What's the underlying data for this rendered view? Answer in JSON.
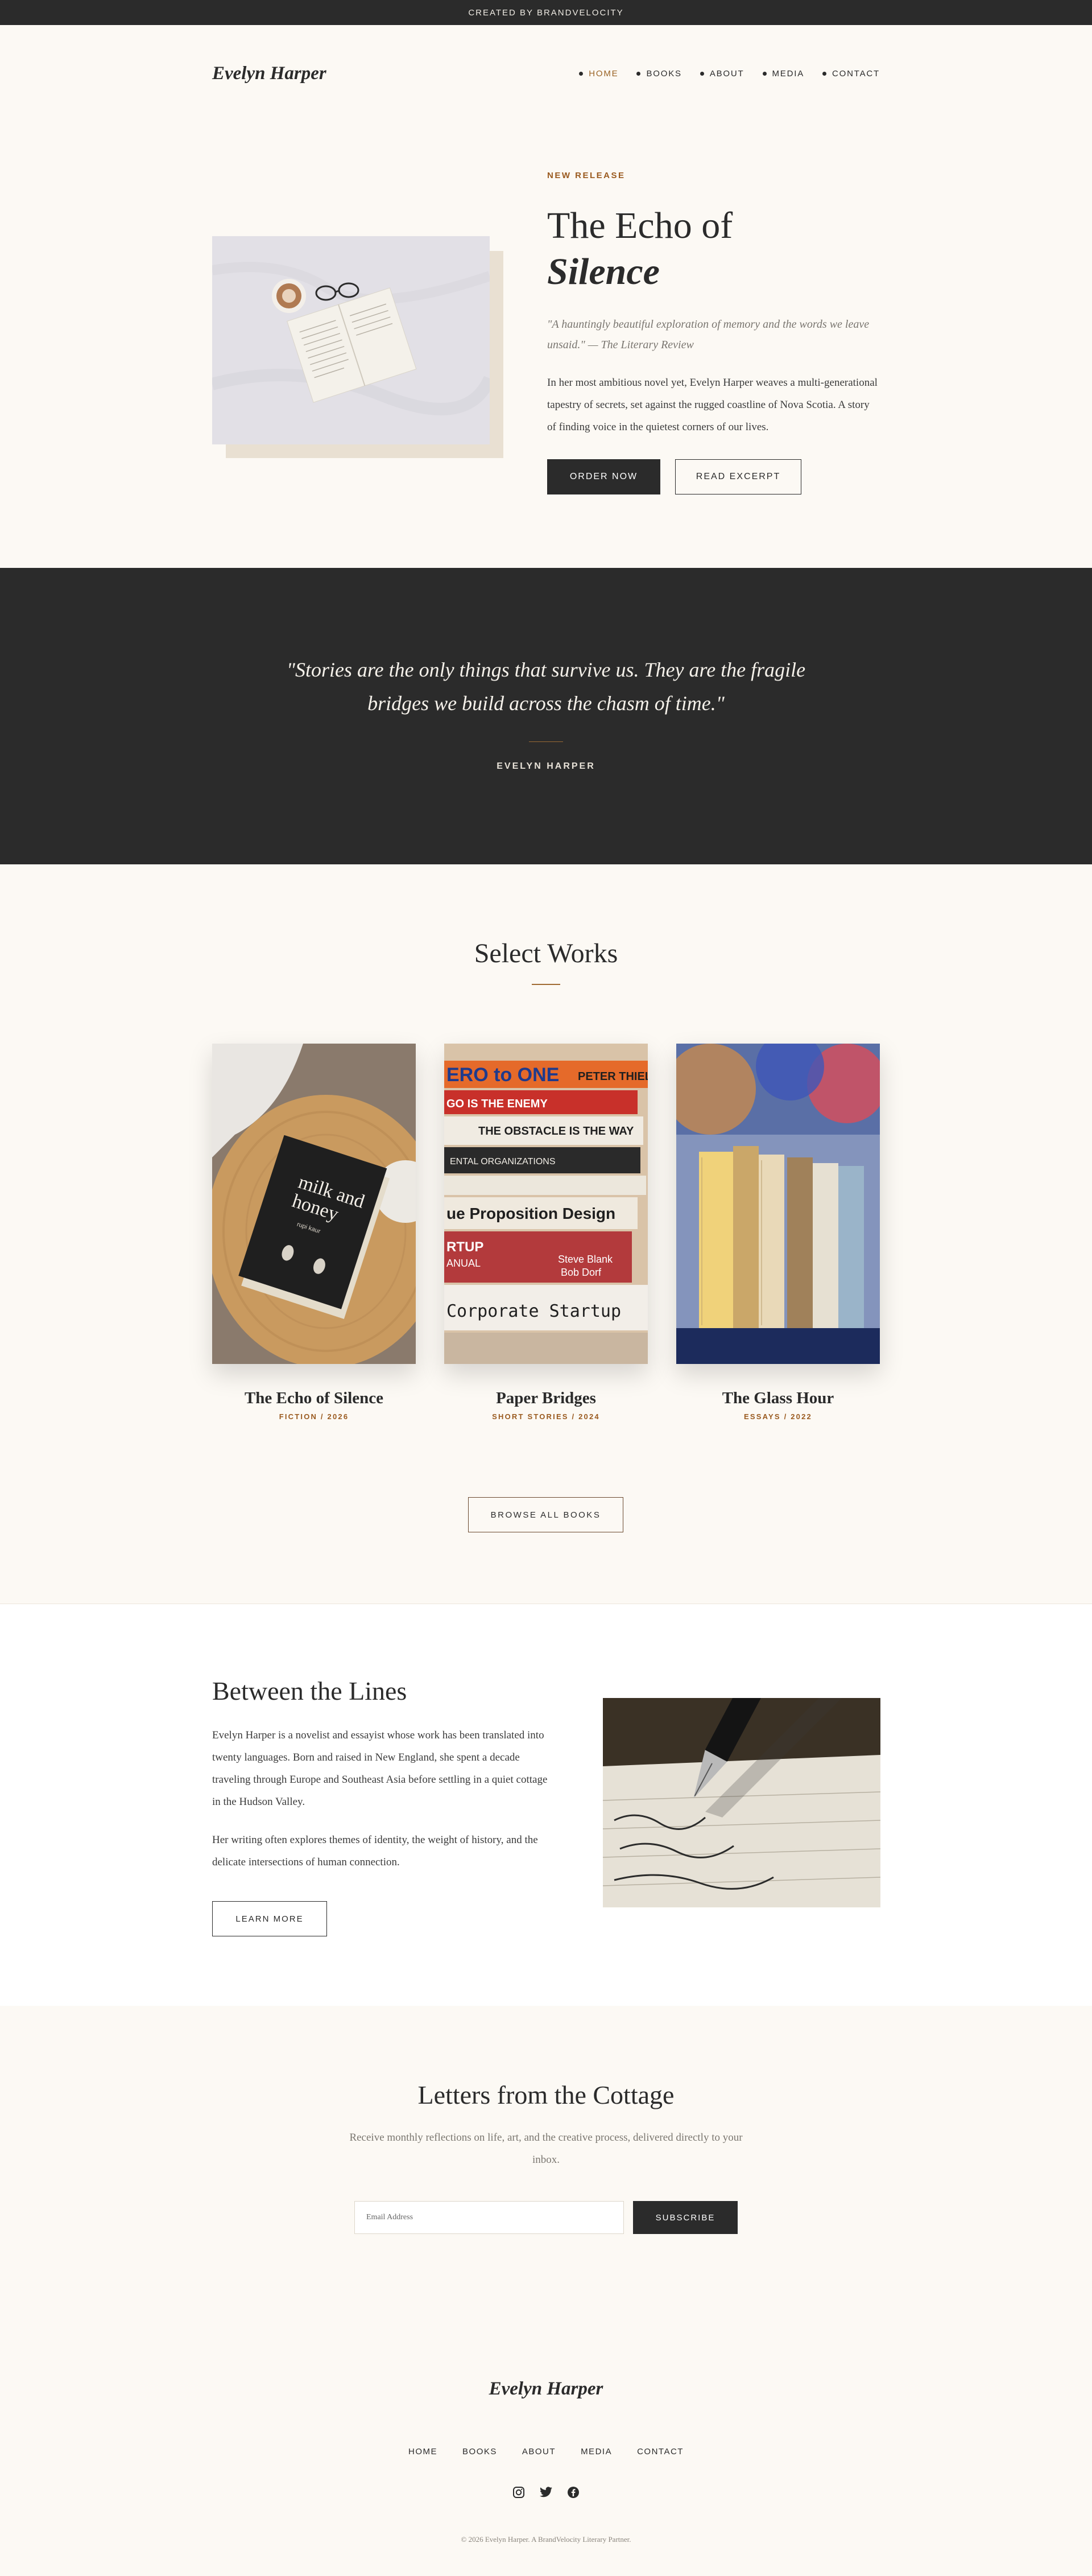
{
  "banner": {
    "text": "CREATED BY BRANDVELOCITY"
  },
  "header": {
    "logo": "Evelyn Harper",
    "nav": [
      {
        "label": "HOME",
        "active": true
      },
      {
        "label": "BOOKS",
        "active": false
      },
      {
        "label": "ABOUT",
        "active": false
      },
      {
        "label": "MEDIA",
        "active": false
      },
      {
        "label": "CONTACT",
        "active": false
      }
    ]
  },
  "hero": {
    "eyebrow": "NEW RELEASE",
    "title_line1": "The Echo of",
    "title_line2": "Silence",
    "quote": "\"A hauntingly beautiful exploration of memory and the words we leave unsaid.\" — The Literary Review",
    "description": "In her most ambitious novel yet, Evelyn Harper weaves a multi-generational tapestry of secrets, set against the rugged coastline of Nova Scotia. A story of finding voice in the quietest corners of our lives.",
    "order_button": "ORDER NOW",
    "excerpt_button": "READ EXCERPT"
  },
  "quote_band": {
    "quote": "\"Stories are the only things that survive us. They are the fragile bridges we build across the chasm of time.\"",
    "author": "EVELYN HARPER"
  },
  "works": {
    "title": "Select Works",
    "books": [
      {
        "title": "The Echo of Silence",
        "meta": "FICTION / 2026"
      },
      {
        "title": "Paper Bridges",
        "meta": "SHORT STORIES / 2024"
      },
      {
        "title": "The Glass Hour",
        "meta": "ESSAYS / 2022"
      }
    ],
    "browse_button": "BROWSE ALL BOOKS"
  },
  "about": {
    "title": "Between the Lines",
    "p1": "Evelyn Harper is a novelist and essayist whose work has been translated into twenty languages. Born and raised in New England, she spent a decade traveling through Europe and Southeast Asia before settling in a quiet cottage in the Hudson Valley.",
    "p2": "Her writing often explores themes of identity, the weight of history, and the delicate intersections of human connection.",
    "button": "LEARN MORE"
  },
  "newsletter": {
    "title": "Letters from the Cottage",
    "subtitle": "Receive monthly reflections on life, art, and the creative process, delivered directly to your inbox.",
    "placeholder": "Email Address",
    "button": "SUBSCRIBE"
  },
  "footer": {
    "logo": "Evelyn Harper",
    "nav": [
      "HOME",
      "BOOKS",
      "ABOUT",
      "MEDIA",
      "CONTACT"
    ],
    "socials": [
      "instagram-icon",
      "twitter-icon",
      "facebook-icon"
    ],
    "copyright": "© 2026 Evelyn Harper. A BrandVelocity Literary Partner."
  },
  "colors": {
    "accent": "#9a5a1f",
    "dark": "#2b2b2b",
    "background": "#fcf9f4"
  }
}
